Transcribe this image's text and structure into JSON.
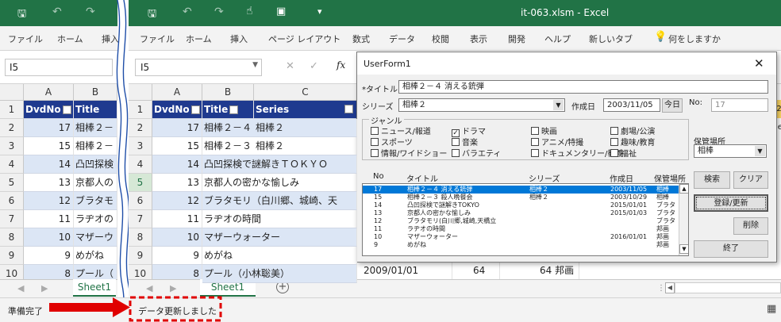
{
  "left_window": {
    "ribbon": [
      "ファイル",
      "ホーム",
      "挿入"
    ],
    "name_box": "I5",
    "cols": [
      "A",
      "B"
    ],
    "header": {
      "dvdno": "DvdNo",
      "title": "Title"
    },
    "row_nums": [
      "1",
      "2",
      "3",
      "4",
      "5",
      "6",
      "7",
      "8",
      "9",
      "10"
    ],
    "rows": [
      [
        "17",
        "相棒２－"
      ],
      [
        "15",
        "相棒２－"
      ],
      [
        "14",
        "凸凹探検"
      ],
      [
        "13",
        "京都人の"
      ],
      [
        "12",
        "ブラタモ"
      ],
      [
        "11",
        "ラヂオの"
      ],
      [
        "10",
        "マザーウ"
      ],
      [
        "9",
        "めがね"
      ],
      [
        "8",
        "プール（"
      ]
    ],
    "sheet_tab": "Sheet1",
    "status": "準備完了"
  },
  "right_window": {
    "filename": "it-063.xlsm - Excel",
    "ribbon": [
      "ファイル",
      "ホーム",
      "挿入",
      "ページ レイアウト",
      "数式",
      "データ",
      "校閲",
      "表示",
      "開発",
      "ヘルプ",
      "新しいタブ",
      "何をしますか"
    ],
    "name_box": "I5",
    "fx": "fx",
    "cols": [
      "A",
      "B",
      "C"
    ],
    "header": {
      "dvdno": "DvdNo",
      "title": "Title",
      "series": "Series"
    },
    "row_nums": [
      "1",
      "2",
      "3",
      "4",
      "5",
      "6",
      "7",
      "8",
      "9",
      "10"
    ],
    "rows": [
      [
        "17",
        "相棒２－４",
        "相棒２"
      ],
      [
        "15",
        "相棒２－３",
        "相棒２"
      ],
      [
        "14",
        "凸凹探検で謎解きＴＯＫＹＯ",
        ""
      ],
      [
        "13",
        "京都人の密かな愉しみ",
        ""
      ],
      [
        "12",
        "ブラタモリ（白川郷、城崎、天",
        ""
      ],
      [
        "11",
        "ラヂオの時間",
        ""
      ],
      [
        "10",
        "マザーウォーター",
        ""
      ],
      [
        "9",
        "めがね",
        ""
      ],
      [
        "8",
        "プール（小林聡美）",
        ""
      ]
    ],
    "last_row_extra": [
      "2009/01/01",
      "64",
      "64 邦画"
    ],
    "sheet_tab": "Sheet1",
    "status_message": "データ更新しました",
    "edge_frag": [
      "72",
      "Ge"
    ]
  },
  "userform": {
    "title": "UserForm1",
    "labels": {
      "title": "*タイトル",
      "series": "シリーズ",
      "created": "作成日",
      "no": "No:",
      "genre": "ジャンル",
      "storage": "保管場所"
    },
    "title_value": "相棒２－４ 消える銃弾",
    "series_value": "相棒２",
    "date_value": "2003/11/05",
    "today_button": "今日",
    "no_value": "17",
    "genres": [
      {
        "label": "ニュース/報道",
        "checked": false
      },
      {
        "label": "ドラマ",
        "checked": true
      },
      {
        "label": "映画",
        "checked": false
      },
      {
        "label": "劇場/公演",
        "checked": false
      },
      {
        "label": "スポーツ",
        "checked": false
      },
      {
        "label": "音楽",
        "checked": false
      },
      {
        "label": "アニメ/特撮",
        "checked": false
      },
      {
        "label": "趣味/教育",
        "checked": false
      },
      {
        "label": "情報/ワイドショー",
        "checked": false
      },
      {
        "label": "バラエティ",
        "checked": false
      },
      {
        "label": "ドキュメンタリー/教養",
        "checked": false
      },
      {
        "label": "福祉",
        "checked": false
      }
    ],
    "storage_value": "相棒",
    "list_headers": [
      "No",
      "タイトル",
      "シリーズ",
      "作成日",
      "保管場所"
    ],
    "list_rows": [
      [
        "17",
        "相棒２－４ 消える銃弾",
        "相棒２",
        "2003/11/05",
        "相棒"
      ],
      [
        "15",
        "相棒２－３ 殺人晩餐会",
        "相棒２",
        "2003/10/29",
        "相棒"
      ],
      [
        "14",
        "凸凹探検で謎解きTOKYO",
        "",
        "2015/01/01",
        "ブラタ"
      ],
      [
        "13",
        "京都人の密かな愉しみ",
        "",
        "2015/01/03",
        "ブラタ"
      ],
      [
        "12",
        "ブラタモリ(白川郷,城崎,天橋立",
        "",
        "",
        "ブラタ"
      ],
      [
        "11",
        "ラヂオの時間",
        "",
        "",
        "邦画"
      ],
      [
        "10",
        "マザーウォーター",
        "",
        "2016/01/01",
        "邦画"
      ],
      [
        "9",
        "めがね",
        "",
        "",
        "邦画"
      ]
    ],
    "buttons": {
      "search": "検索",
      "clear": "クリア",
      "register": "登録/更新",
      "delete": "削除",
      "exit": "終了"
    }
  },
  "colors": {
    "excel_green": "#217346",
    "header_blue": "#1f3a8f",
    "band": "#dce6f5",
    "annotation_red": "#e00000"
  }
}
